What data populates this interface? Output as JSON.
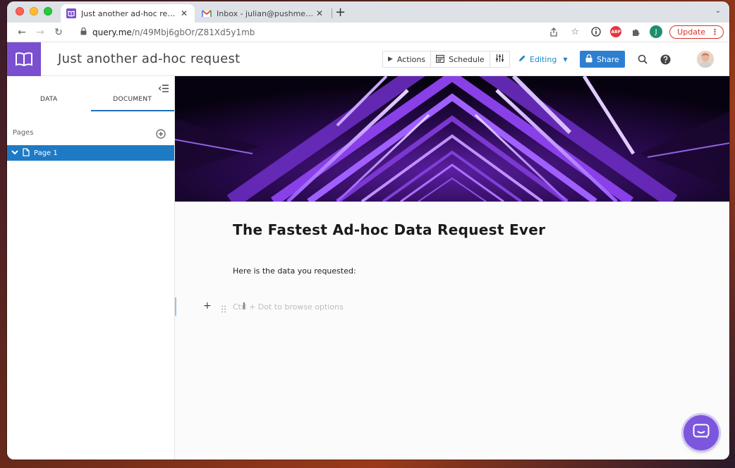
{
  "browser": {
    "tabs": [
      {
        "title": "Just another ad-hoc request |",
        "active": true
      },
      {
        "title": "Inbox - julian@pushmetrics.io -",
        "active": false
      }
    ],
    "url_host": "query.me",
    "url_path": "/n/49Mbj6gbOr/Z81Xd5y1mb",
    "profile_initial": "J",
    "abp_label": "ABP",
    "update_label": "Update"
  },
  "app": {
    "doc_title": "Just another ad-hoc request",
    "toolbar": {
      "actions_label": "Actions",
      "schedule_label": "Schedule",
      "editing_label": "Editing",
      "share_label": "Share"
    },
    "accent_color": "#7a4fd0",
    "share_color": "#2d7fd0"
  },
  "sidebar": {
    "tabs": [
      "DATA",
      "DOCUMENT"
    ],
    "active_tab": "DOCUMENT",
    "pages_label": "Pages",
    "pages": [
      {
        "label": "Page 1",
        "selected": true
      }
    ]
  },
  "document": {
    "heading": "The Fastest Ad-hoc Data Request Ever",
    "paragraph": "Here is the data you requested:",
    "placeholder": "Ctrl + Dot to browse options"
  }
}
